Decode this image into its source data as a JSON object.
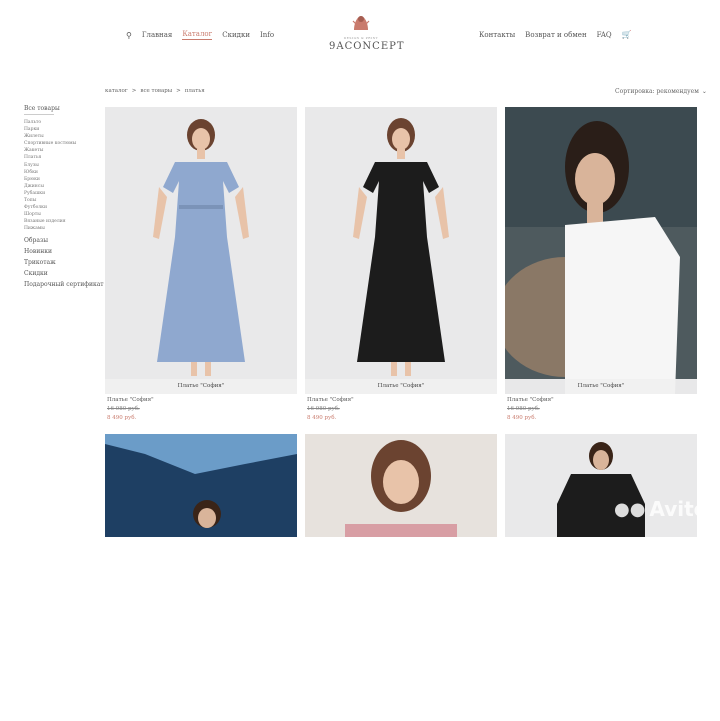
{
  "nav": {
    "left": [
      "Главная",
      "Каталог",
      "Скидки",
      "Info"
    ],
    "right": [
      "Контакты",
      "Возврат и обмен",
      "FAQ"
    ]
  },
  "logo": {
    "text": "9ACONCEPT",
    "tag": "DESIGN & PRINT"
  },
  "breadcrumb": [
    "каталог",
    ">",
    "все товары",
    ">",
    "платья"
  ],
  "sort": {
    "label": "Сортировка: рекомендуем",
    "icon": "chevron-down-icon"
  },
  "sidebar": {
    "head": "Все товары",
    "items": [
      "Пальто",
      "Парки",
      "Жилеты",
      "Спортивные костюмы",
      "Жакеты",
      "Платья",
      "Блузы",
      "Юбки",
      "Брюки",
      "Джинсы",
      "Рубашки",
      "Топы",
      "Футболки",
      "Шорты",
      "Вязаные изделия",
      "Пижамы"
    ],
    "sections": [
      "Образы",
      "Новинки",
      "Трикотаж",
      "Скидки",
      "Подарочный сертификат"
    ]
  },
  "products": [
    {
      "label": "Платье \"София\"",
      "name": "Платье \"София\"",
      "old": "16 980 руб.",
      "new": "8 490 руб.",
      "color": "#8fa8cf"
    },
    {
      "label": "Платье \"София\"",
      "name": "Платье \"София\"",
      "old": "16 980 руб.",
      "new": "8 490 руб.",
      "color": "#1c1c1c"
    },
    {
      "label": "Платье \"София\"",
      "name": "Платье \"София\"",
      "old": "16 980 руб.",
      "new": "8 490 руб.",
      "color": "#ffffff"
    }
  ],
  "watermark": "Avito"
}
